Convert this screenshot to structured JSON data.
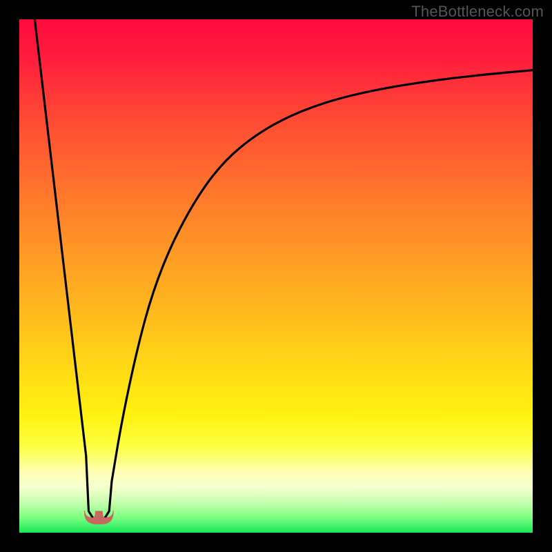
{
  "watermark": "TheBottleneck.com",
  "colors": {
    "frame": "#000000",
    "curve_stroke": "#000000",
    "marker_fill": "#c86860",
    "marker_stroke": "#c86860"
  },
  "chart_data": {
    "type": "line",
    "title": "",
    "xlabel": "",
    "ylabel": "",
    "xlim": [
      0,
      100
    ],
    "ylim": [
      0,
      100
    ],
    "grid": false,
    "legend": false,
    "annotations": [],
    "series": [
      {
        "name": "left-segment",
        "x": [
          3,
          5,
          7,
          9,
          11,
          13
        ],
        "y": [
          100,
          83,
          66,
          49,
          32,
          15
        ]
      },
      {
        "name": "valley-flat",
        "x": [
          13.5,
          14.5,
          15.5,
          16.5,
          17.5
        ],
        "y": [
          4.2,
          2.6,
          2.4,
          2.6,
          4.2
        ]
      },
      {
        "name": "right-curve",
        "x": [
          18,
          20,
          23,
          26,
          30,
          35,
          40,
          46,
          53,
          61,
          70,
          80,
          90,
          100
        ],
        "y": [
          10,
          22,
          36,
          47,
          57,
          66,
          72.5,
          77.5,
          81.4,
          84.3,
          86.4,
          88.0,
          89.2,
          90.1
        ]
      }
    ],
    "marker": {
      "shape": "rounded-u",
      "center_x": 15.5,
      "center_y": 3.0,
      "width": 5.6,
      "height": 2.6
    }
  }
}
